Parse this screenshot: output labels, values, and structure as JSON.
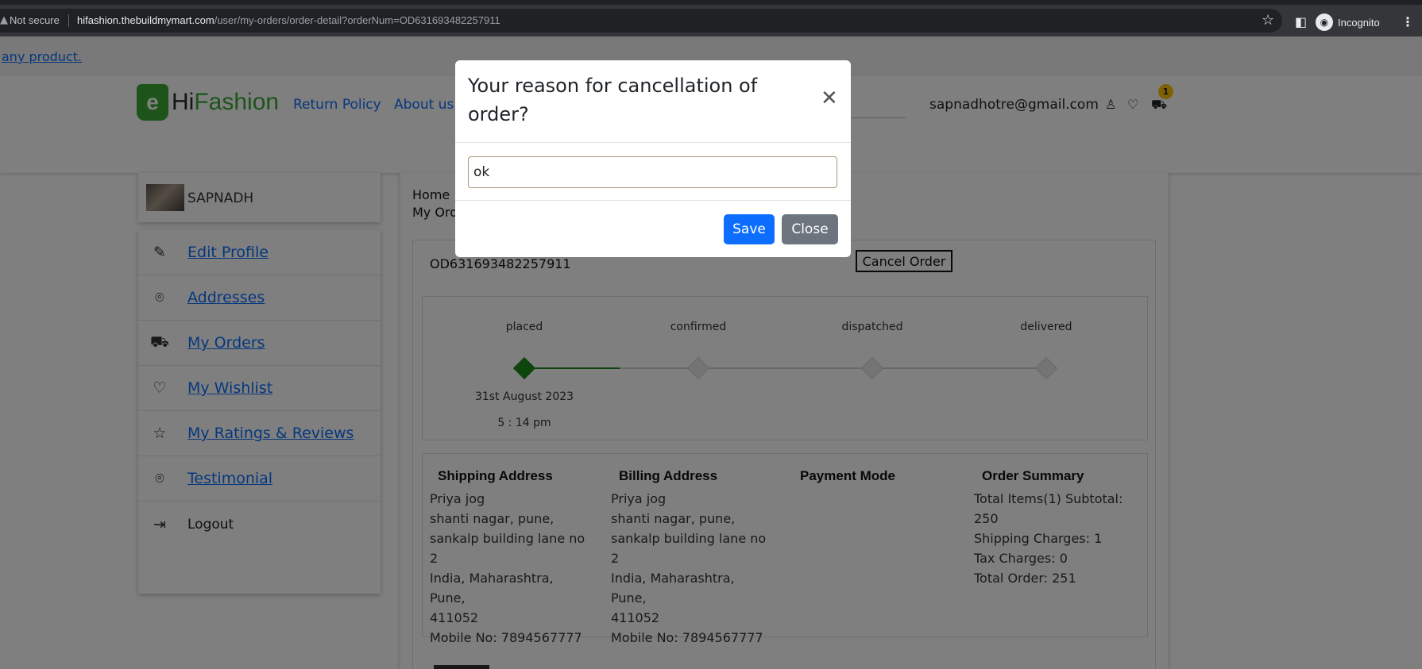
{
  "browser": {
    "security_label": "Not secure",
    "url_host": "hifashion.thebuildmymart.com",
    "url_path": "/user/my-orders/order-detail?orderNum=OD631693482257911",
    "profile_label": "Incognito"
  },
  "page": {
    "top_link": "any product.",
    "logo": {
      "part1": "Hi",
      "part2": "Fashion",
      "badge_letter": "e"
    },
    "nav": {
      "return_policy": "Return Policy",
      "about_us": "About us"
    },
    "user_email": "sapnadhotre@gmail.com",
    "cart_count": "1",
    "profile_name": "SAPNADH",
    "sidebar": {
      "items": [
        {
          "label": "Edit Profile",
          "icon": "edit-icon"
        },
        {
          "label": "Addresses",
          "icon": "location-icon"
        },
        {
          "label": "My Orders",
          "icon": "cart-icon"
        },
        {
          "label": "My Wishlist",
          "icon": "heart-icon"
        },
        {
          "label": "My Ratings & Reviews",
          "icon": "star-icon"
        },
        {
          "label": "Testimonial",
          "icon": "location-icon"
        },
        {
          "label": "Logout",
          "icon": "logout-icon"
        }
      ]
    },
    "breadcrumb": {
      "home": "Home",
      "my_orders": "My Ord"
    },
    "order": {
      "number": "OD631693482257911",
      "cancel_label": "Cancel Order",
      "stages": [
        "placed",
        "confirmed",
        "dispatched",
        "delivered"
      ],
      "active_stage_index": 0,
      "placed_date": "31st August 2023",
      "placed_time": "5 : 14 pm",
      "status_colors": {
        "active": "#1a8a1a",
        "inactive": "#d0d0d0"
      }
    },
    "shipping": {
      "heading": "Shipping Address",
      "name": "Priya jog",
      "line1": "shanti nagar, pune,",
      "line2": "sankalp building lane no",
      "line3": "2",
      "line4": "India, Maharashtra, Pune,",
      "line5": "411052",
      "mobile": "Mobile No: 7894567777"
    },
    "billing": {
      "heading": "Billing Address",
      "name": "Priya jog",
      "line1": "shanti nagar, pune,",
      "line2": "sankalp building lane no",
      "line3": "2",
      "line4": "India, Maharashtra, Pune,",
      "line5": "411052",
      "mobile": "Mobile No: 7894567777"
    },
    "payment": {
      "heading": "Payment Mode"
    },
    "summary": {
      "heading": "Order Summary",
      "line1": "Total Items(1) Subtotal:",
      "line2": "250",
      "line3": "Shipping Charges: 1",
      "line4": "Tax Charges: 0",
      "line5": "Total Order: 251"
    }
  },
  "modal": {
    "title": "Your reason for cancellation of order?",
    "input_value": "ok",
    "save_label": "Save",
    "close_label": "Close",
    "colors": {
      "save": "#0d6efd",
      "close": "#6c757d"
    }
  }
}
